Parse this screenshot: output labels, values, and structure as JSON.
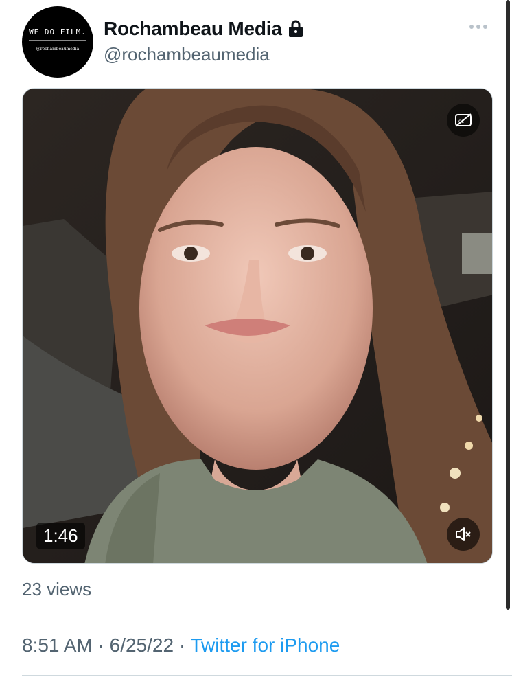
{
  "tweet": {
    "author": {
      "display_name": "Rochambeau Media",
      "handle": "@rochambeaumedia",
      "protected_icon": "lock-icon",
      "avatar": {
        "logo_text": "WE DO FILM.",
        "logo_handle": "@rochambeaumedia"
      }
    },
    "more_icon": "more-horizontal-icon",
    "video": {
      "duration": "1:46",
      "captions_icon": "closed-captions-off-icon",
      "mute_icon": "volume-muted-icon"
    },
    "views": "23 views",
    "time": "8:51 AM",
    "separator": " · ",
    "date": "6/25/22",
    "source": "Twitter for iPhone"
  },
  "colors": {
    "text_primary": "#0f1419",
    "text_secondary": "#536471",
    "link": "#1d9bf0",
    "divider": "#cfd9de"
  }
}
